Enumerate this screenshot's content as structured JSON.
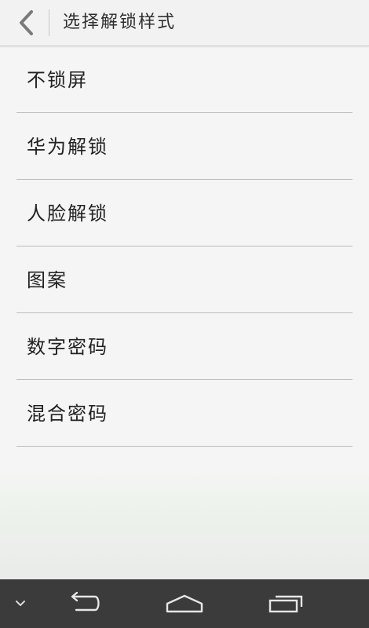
{
  "header": {
    "title": "选择解锁样式",
    "back_icon": "chevron-left-icon"
  },
  "lock_options": [
    {
      "label": "不锁屏"
    },
    {
      "label": "华为解锁"
    },
    {
      "label": "人脸解锁"
    },
    {
      "label": "图案"
    },
    {
      "label": "数字密码"
    },
    {
      "label": "混合密码"
    }
  ],
  "nav_bar": {
    "icons": [
      "chevron-down-icon",
      "back-arrow-icon",
      "home-icon",
      "recent-apps-icon"
    ]
  },
  "colors": {
    "nav_bar_bg": "#3b3b3b",
    "icon_color": "#7a7a7a",
    "nav_icon_color": "#e6e6e6"
  }
}
